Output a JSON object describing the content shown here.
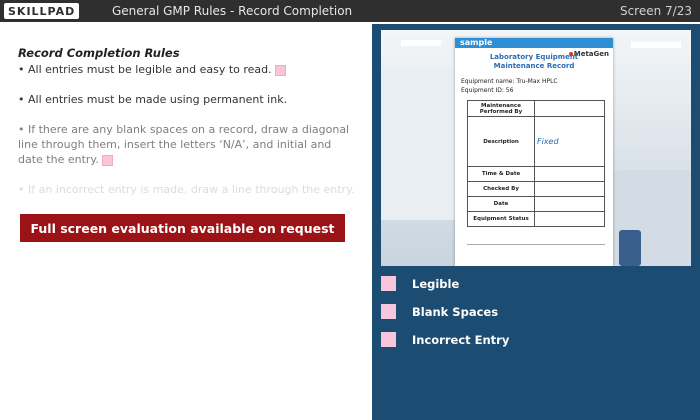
{
  "header": {
    "logo": "SKILLPAD",
    "title": "General GMP Rules - Record Completion",
    "screen": "Screen 7/23"
  },
  "rules": {
    "heading": "Record Completion Rules",
    "bullets": [
      "• All entries must be legible and easy to read.",
      "• All entries must be made using permanent ink.",
      "• If there are any blank spaces on a record, draw a diagonal line through them, insert the letters ‘N/A’, and initial and date the entry.",
      "• If an incorrect entry is made, draw a line through the entry."
    ]
  },
  "cta": {
    "label": "Full screen evaluation available on request"
  },
  "document": {
    "tag": "sample",
    "brand": "MetaGen",
    "title_line1": "Laboratory Equipment",
    "title_line2": "Maintenance Record",
    "equipment_name": "Equipment name: Tru-Max HPLC",
    "equipment_id": "Equipment ID: 56",
    "rows": [
      {
        "label": "Maintenance Performed By",
        "value": ""
      },
      {
        "label": "Description",
        "value": "Fixed"
      },
      {
        "label": "Time & Date",
        "value": ""
      },
      {
        "label": "Checked By",
        "value": ""
      },
      {
        "label": "Date",
        "value": ""
      },
      {
        "label": "Equipment Status",
        "value": ""
      }
    ]
  },
  "options": [
    {
      "label": "Legible"
    },
    {
      "label": "Blank Spaces"
    },
    {
      "label": "Incorrect Entry"
    }
  ],
  "colors": {
    "topbar": "#2f2f2f",
    "panel": "#1d4c72",
    "cta": "#9b1316",
    "checkbox": "#f8c6dc"
  }
}
